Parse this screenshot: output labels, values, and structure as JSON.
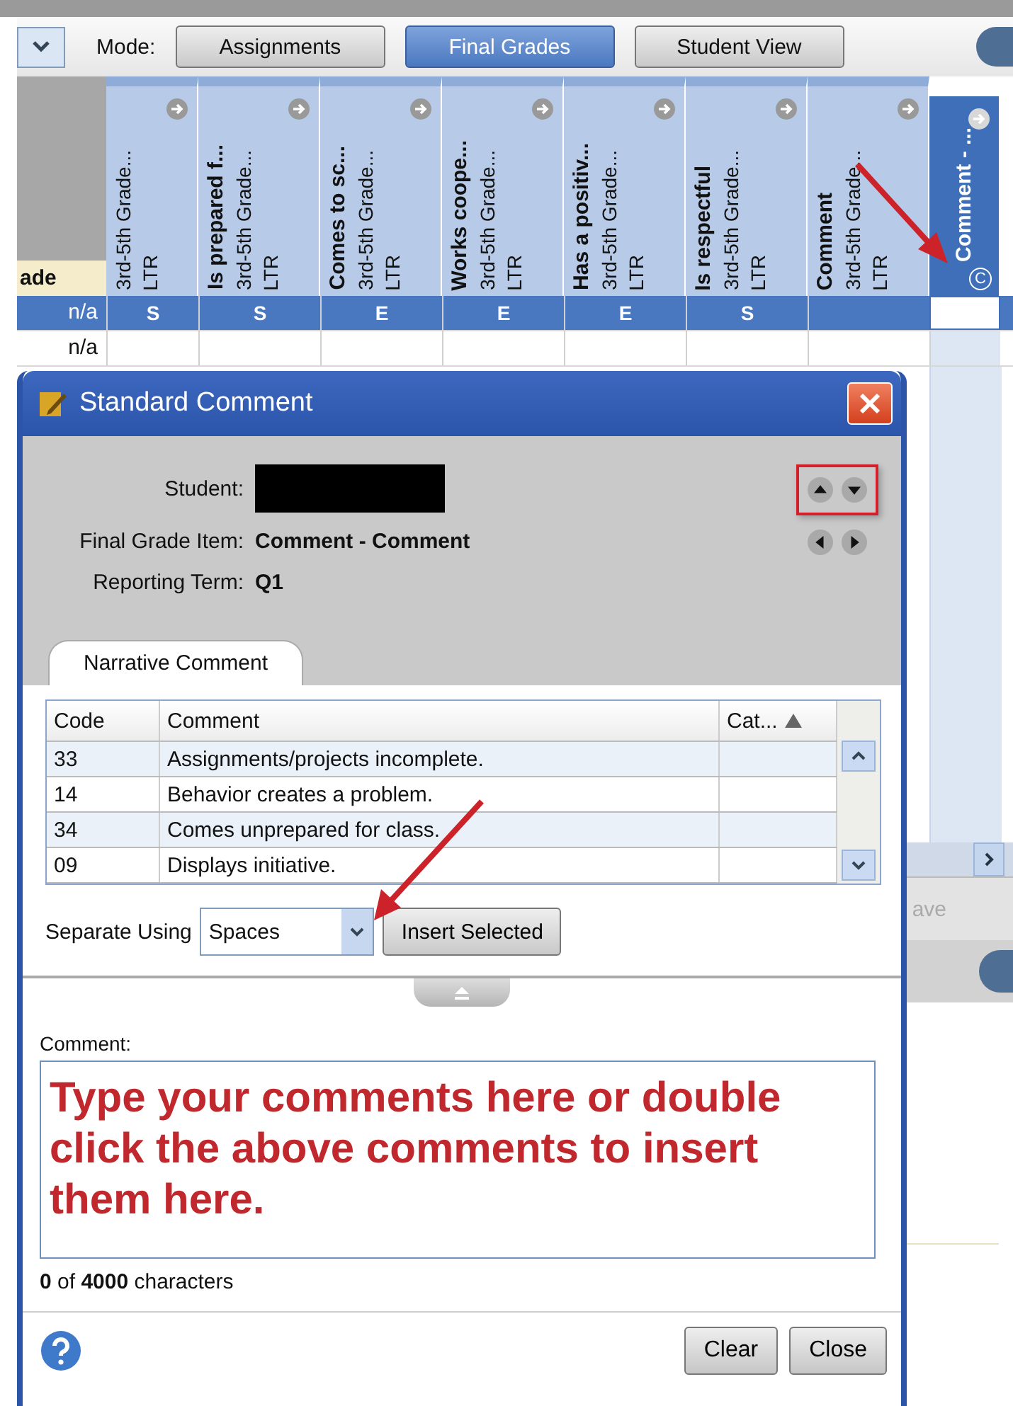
{
  "toolbar": {
    "mode_label": "Mode:",
    "modes": [
      {
        "label": "Assignments",
        "selected": false
      },
      {
        "label": "Final Grades",
        "selected": true
      },
      {
        "label": "Student View",
        "selected": false
      }
    ]
  },
  "grid": {
    "left_header": "ade",
    "columns": [
      {
        "course": "3rd-5th Grade...",
        "type": "LTR",
        "selected": false
      },
      {
        "title": "Is prepared f...",
        "course": "3rd-5th Grade...",
        "type": "LTR",
        "selected": false
      },
      {
        "title": "Comes to sc...",
        "course": "3rd-5th Grade...",
        "type": "LTR",
        "selected": false
      },
      {
        "title": "Works coope...",
        "course": "3rd-5th Grade...",
        "type": "LTR",
        "selected": false
      },
      {
        "title": "Has a positiv...",
        "course": "3rd-5th Grade...",
        "type": "LTR",
        "selected": false
      },
      {
        "title": "Is respectful",
        "course": "3rd-5th Grade...",
        "type": "LTR",
        "selected": false
      },
      {
        "title": "Comment",
        "course": "3rd-5th Grade...",
        "type": "LTR",
        "selected": false
      },
      {
        "title": "Comment - ...",
        "badge": "C",
        "selected": true
      }
    ],
    "rows": [
      {
        "score": "n/a",
        "selected": true,
        "cells": [
          "S",
          "S",
          "E",
          "E",
          "E",
          "S"
        ]
      },
      {
        "score": "n/a",
        "selected": false
      }
    ]
  },
  "backdrop": {
    "partial_button": "ave"
  },
  "dialog": {
    "title": "Standard Comment",
    "fields": [
      {
        "label": "Student:",
        "kind": "redacted"
      },
      {
        "label": "Final Grade Item:",
        "kind": "text",
        "value": "Comment - Comment"
      },
      {
        "label": "Reporting Term:",
        "kind": "text",
        "value": "Q1"
      }
    ],
    "tabs": [
      {
        "label": "Narrative Comment",
        "selected": true
      }
    ],
    "table": {
      "columns": [
        "Code",
        "Comment",
        "Cat..."
      ],
      "rows": [
        {
          "code": "33",
          "comment": "Assignments/projects incomplete."
        },
        {
          "code": "14",
          "comment": "Behavior creates a problem."
        },
        {
          "code": "34",
          "comment": "Comes unprepared for class."
        },
        {
          "code": "09",
          "comment": "Displays initiative."
        }
      ]
    },
    "separator": {
      "label": "Separate Using",
      "value": "Spaces",
      "button": "Insert Selected"
    },
    "comment": {
      "label": "Comment:",
      "placeholder": "Type your comments here or double click the above comments to insert them here.",
      "counter": "**0** of **4000** characters"
    },
    "buttons": [
      "Clear",
      "Close"
    ]
  }
}
